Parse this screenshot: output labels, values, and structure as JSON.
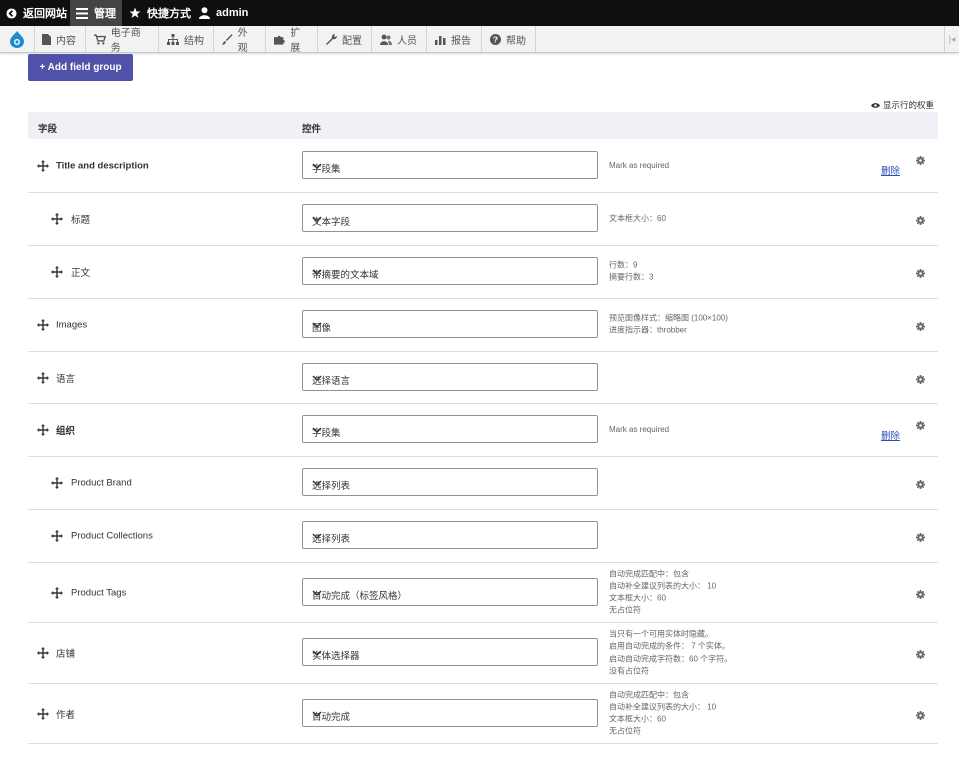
{
  "toolbar": {
    "back_site": "返回网站",
    "manage": "管理",
    "shortcuts": "快捷方式",
    "user": "admin"
  },
  "tray": {
    "items": [
      "内容",
      "电子商务",
      "结构",
      "外观",
      "扩展",
      "配置",
      "人员",
      "报告",
      "帮助"
    ]
  },
  "actions": {
    "add_field_group": "+ Add field group",
    "show_weights": "显示行的权重"
  },
  "table": {
    "col_field": "字段",
    "col_widget": "控件",
    "delete_label": "删除",
    "rows": [
      {
        "label": "Title and description",
        "widget": "字段集",
        "summary": [
          "Mark as required"
        ],
        "delete": true
      },
      {
        "label": "标题",
        "widget": "文本字段",
        "summary": [
          "文本框大小：60"
        ]
      },
      {
        "label": "正文",
        "widget": "带摘要的文本域",
        "summary": [
          "行数：9",
          "摘要行数：3"
        ]
      },
      {
        "label": "Images",
        "widget": "图像",
        "summary": [
          "预览图像样式：缩略图 (100×100)",
          "进度指示器：throbber"
        ]
      },
      {
        "label": "语言",
        "widget": "选择语言",
        "summary": []
      },
      {
        "label": "组织",
        "widget": "字段集",
        "summary": [
          "Mark as required"
        ],
        "delete": true
      },
      {
        "label": "Product Brand",
        "widget": "选择列表",
        "summary": []
      },
      {
        "label": "Product Collections",
        "widget": "选择列表",
        "summary": []
      },
      {
        "label": "Product Tags",
        "widget": "自动完成（标签风格）",
        "summary": [
          "自动完成匹配中：包含",
          "自动补全建议列表的大小： 10",
          "文本框大小：60",
          "无占位符"
        ]
      },
      {
        "label": "店铺",
        "widget": "实体选择器",
        "summary": [
          "当只有一个可用实体时隐藏。",
          "启用自动完成的条件： 7 个实体。",
          "启动自动完成字符数：60 个字符。",
          "没有占位符"
        ]
      },
      {
        "label": "作者",
        "widget": "自动完成",
        "summary": [
          "自动完成匹配中：包含",
          "自动补全建议列表的大小： 10",
          "文本框大小：60",
          "无占位符"
        ]
      }
    ]
  },
  "colors": {
    "toolbar_bg": "#0f0f0f",
    "accent_button": "#4f52a8",
    "link": "#2a4fb5",
    "table_header_bg": "#f0f1f6"
  }
}
